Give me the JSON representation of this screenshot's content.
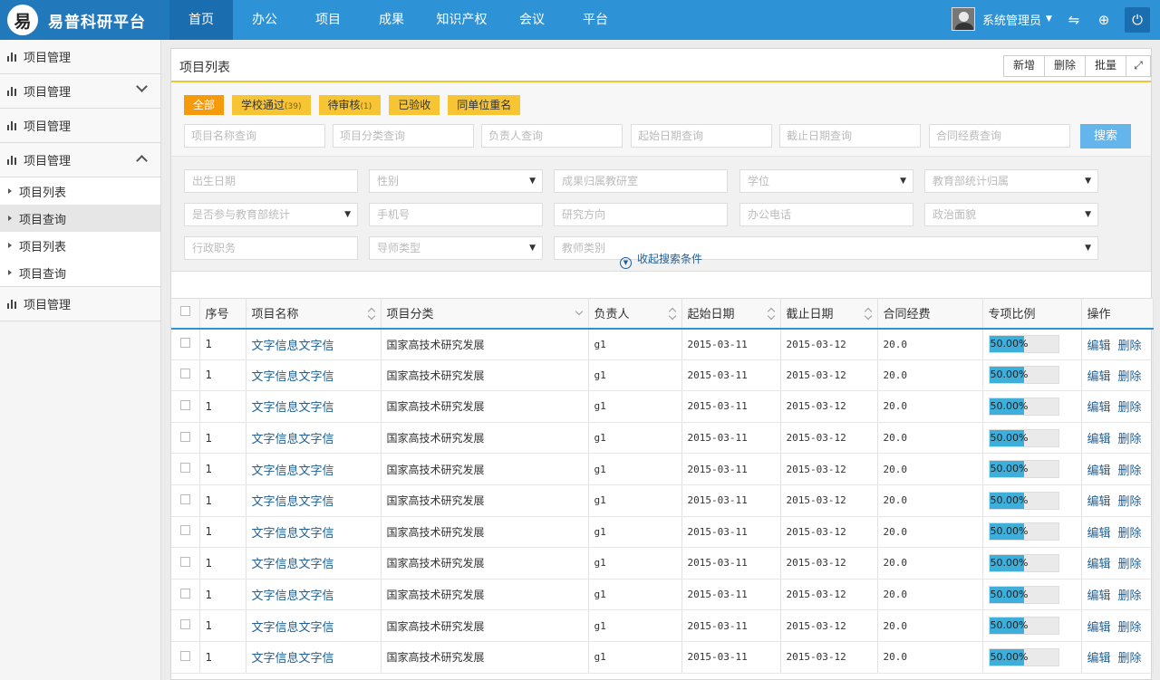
{
  "header": {
    "title": "易普科研平台",
    "logo_glyph": "易",
    "nav": [
      "首页",
      "办公",
      "项目",
      "成果",
      "知识产权",
      "会议",
      "平台"
    ],
    "user_name": "系统管理员"
  },
  "sidebar": {
    "groups": [
      "项目管理",
      "项目管理",
      "项目管理",
      "项目管理",
      "项目管理"
    ],
    "subitems": [
      "项目列表",
      "项目查询",
      "项目列表",
      "项目查询"
    ]
  },
  "panel": {
    "title": "项目列表",
    "buttons": [
      "新增",
      "删除",
      "批量"
    ]
  },
  "filter": {
    "tags": [
      {
        "label": "全部",
        "count": ""
      },
      {
        "label": "学校通过",
        "count": "(39)"
      },
      {
        "label": "待审核",
        "count": "(1)"
      },
      {
        "label": "已验收",
        "count": ""
      },
      {
        "label": "同单位重名",
        "count": ""
      }
    ],
    "query_placeholders": [
      "项目名称查询",
      "项目分类查询",
      "负责人查询",
      "起始日期查询",
      "截止日期查询",
      "合同经费查询"
    ],
    "search_label": "搜索"
  },
  "advanced": {
    "fields": [
      "出生日期",
      "性别",
      "成果归属教研室",
      "学位",
      "教育部统计归属",
      "是否参与教育部统计",
      "手机号",
      "研究方向",
      "办公电话",
      "政治面貌",
      "行政职务",
      "导师类型",
      "教师类别"
    ],
    "collapse_label": "收起搜索条件"
  },
  "table": {
    "columns": [
      "序号",
      "项目名称",
      "项目分类",
      "负责人",
      "起始日期",
      "截止日期",
      "合同经费",
      "专项比例",
      "操作"
    ],
    "row_actions": [
      "编辑",
      "删除"
    ],
    "rows": [
      {
        "no": "1",
        "name": "文字信息文字信",
        "category": "国家高技术研究发展",
        "owner": "g1",
        "start": "2015-03-11",
        "end": "2015-03-12",
        "budget": "20.0",
        "ratio_text": "50.00%",
        "ratio": 0.5
      },
      {
        "no": "1",
        "name": "文字信息文字信",
        "category": "国家高技术研究发展",
        "owner": "g1",
        "start": "2015-03-11",
        "end": "2015-03-12",
        "budget": "20.0",
        "ratio_text": "50.00%",
        "ratio": 0.5
      },
      {
        "no": "1",
        "name": "文字信息文字信",
        "category": "国家高技术研究发展",
        "owner": "g1",
        "start": "2015-03-11",
        "end": "2015-03-12",
        "budget": "20.0",
        "ratio_text": "50.00%",
        "ratio": 0.5
      },
      {
        "no": "1",
        "name": "文字信息文字信",
        "category": "国家高技术研究发展",
        "owner": "g1",
        "start": "2015-03-11",
        "end": "2015-03-12",
        "budget": "20.0",
        "ratio_text": "50.00%",
        "ratio": 0.5
      },
      {
        "no": "1",
        "name": "文字信息文字信",
        "category": "国家高技术研究发展",
        "owner": "g1",
        "start": "2015-03-11",
        "end": "2015-03-12",
        "budget": "20.0",
        "ratio_text": "50.00%",
        "ratio": 0.5
      },
      {
        "no": "1",
        "name": "文字信息文字信",
        "category": "国家高技术研究发展",
        "owner": "g1",
        "start": "2015-03-11",
        "end": "2015-03-12",
        "budget": "20.0",
        "ratio_text": "50.00%",
        "ratio": 0.5
      },
      {
        "no": "1",
        "name": "文字信息文字信",
        "category": "国家高技术研究发展",
        "owner": "g1",
        "start": "2015-03-11",
        "end": "2015-03-12",
        "budget": "20.0",
        "ratio_text": "50.00%",
        "ratio": 0.5
      },
      {
        "no": "1",
        "name": "文字信息文字信",
        "category": "国家高技术研究发展",
        "owner": "g1",
        "start": "2015-03-11",
        "end": "2015-03-12",
        "budget": "20.0",
        "ratio_text": "50.00%",
        "ratio": 0.5
      },
      {
        "no": "1",
        "name": "文字信息文字信",
        "category": "国家高技术研究发展",
        "owner": "g1",
        "start": "2015-03-11",
        "end": "2015-03-12",
        "budget": "20.0",
        "ratio_text": "50.00%",
        "ratio": 0.5
      },
      {
        "no": "1",
        "name": "文字信息文字信",
        "category": "国家高技术研究发展",
        "owner": "g1",
        "start": "2015-03-11",
        "end": "2015-03-12",
        "budget": "20.0",
        "ratio_text": "50.00%",
        "ratio": 0.5
      },
      {
        "no": "1",
        "name": "文字信息文字信",
        "category": "国家高技术研究发展",
        "owner": "g1",
        "start": "2015-03-11",
        "end": "2015-03-12",
        "budget": "20.0",
        "ratio_text": "50.00%",
        "ratio": 0.5
      }
    ]
  },
  "colors": {
    "topbar": "#2e93d6",
    "brand_bg": "#2178ba",
    "nav_active": "#1a6eb0",
    "tag": "#f7c534",
    "tag_active": "#f59b0b",
    "link": "#1f5f95",
    "progress": "#3eaedb",
    "search_button": "#64b5ec"
  },
  "icons": {
    "logo": "brand-logo-icon",
    "user_caret": "caret-down-icon",
    "share": "share-icon",
    "add": "plus-circle-icon",
    "power": "power-icon",
    "sidebar": "bar-chart-icon",
    "expand": "expand-icon",
    "collapse": "chevron-up-circle-icon",
    "sort": "sort-icon"
  }
}
